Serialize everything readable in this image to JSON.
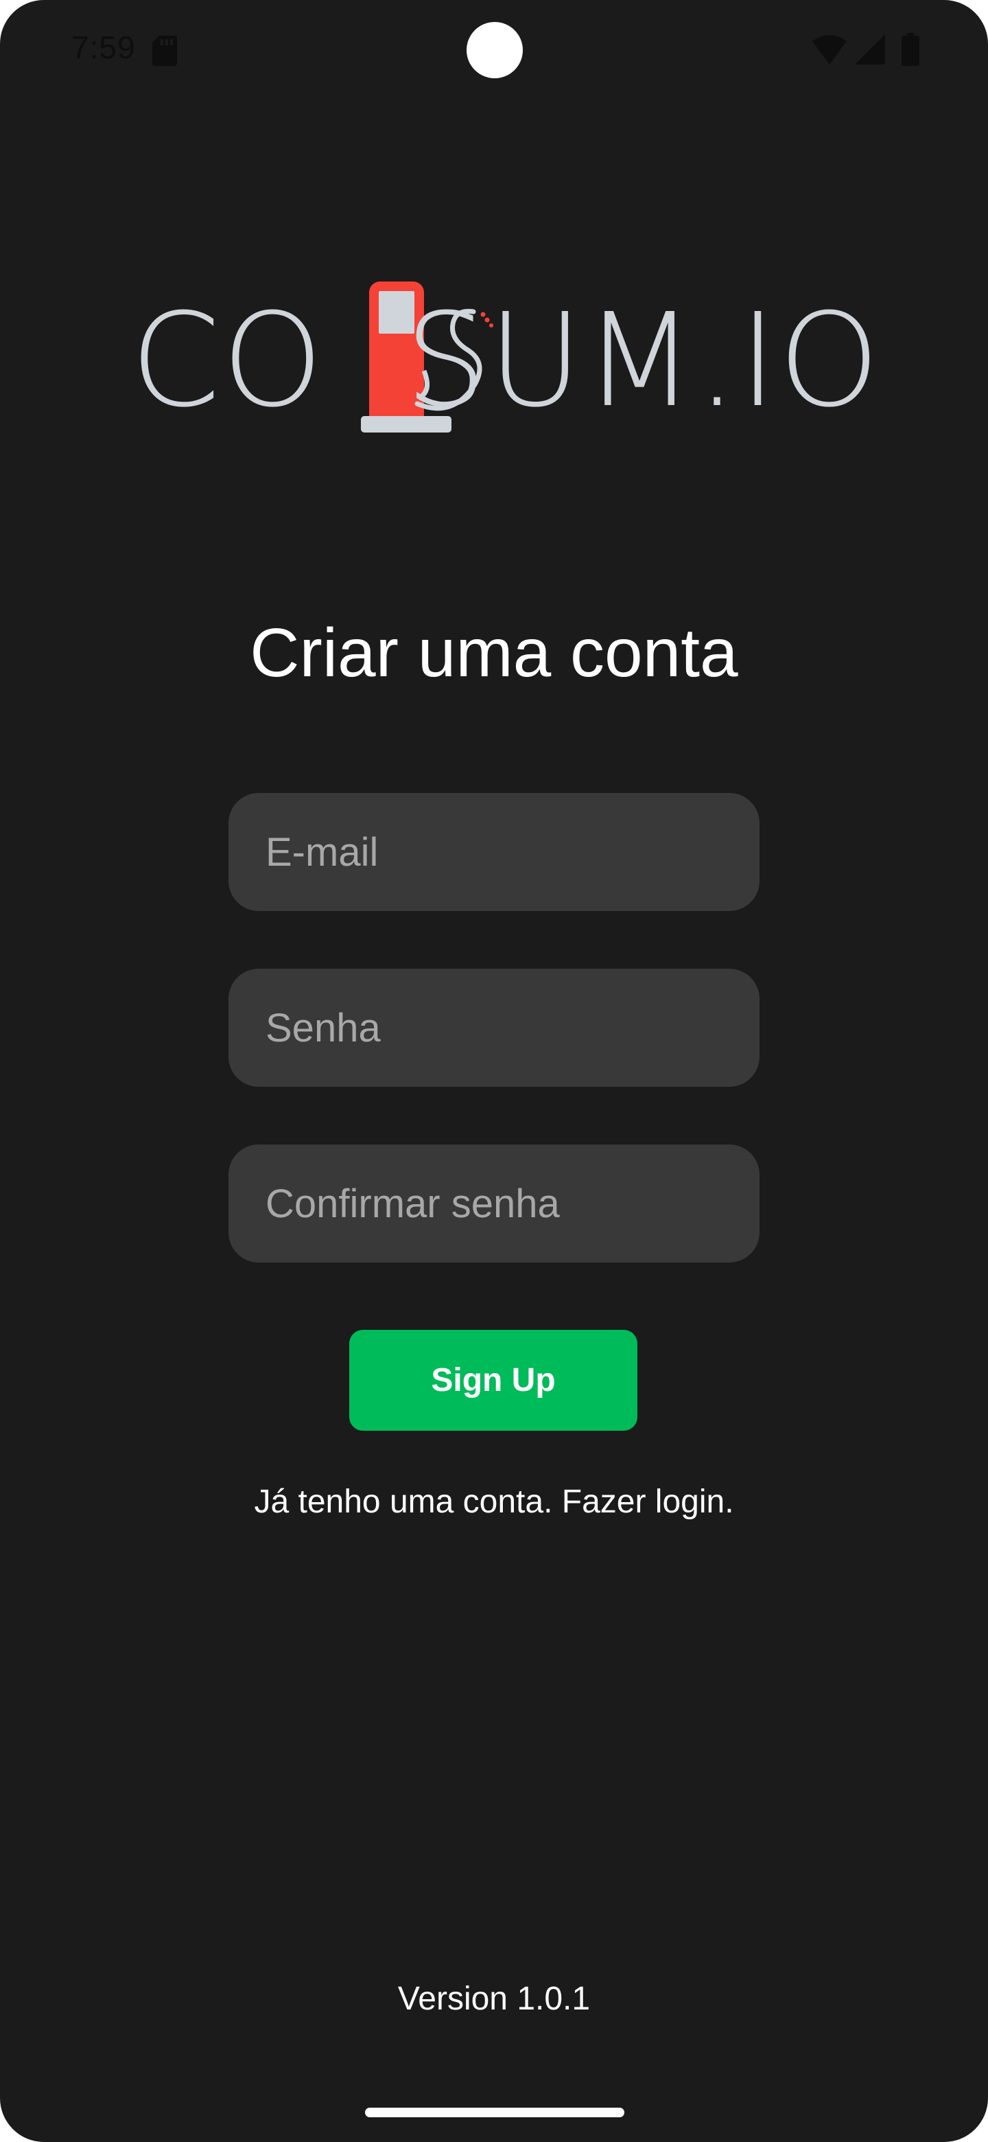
{
  "status_bar": {
    "time": "7:59",
    "icons": [
      "sd-card-icon",
      "wifi-icon",
      "signal-icon",
      "battery-icon"
    ]
  },
  "logo": {
    "text_left": "CO",
    "text_right": "SUM.IO",
    "pump_icon": "fuel-pump-icon",
    "colors": {
      "text": "#cfd5da",
      "pump": "#f44236",
      "pump_window": "#cfd5da"
    }
  },
  "page": {
    "title": "Criar uma conta"
  },
  "form": {
    "email_placeholder": "E-mail",
    "email_value": "",
    "password_placeholder": "Senha",
    "password_value": "",
    "confirm_placeholder": "Confirmar senha",
    "confirm_value": "",
    "submit_label": "Sign Up"
  },
  "login_link": "Já tenho uma conta. Fazer login.",
  "version": "Version 1.0.1",
  "colors": {
    "background": "#1b1b1b",
    "field_background": "#393939",
    "button": "#00bb59",
    "text": "#ffffff",
    "placeholder": "#a8a8a8"
  }
}
